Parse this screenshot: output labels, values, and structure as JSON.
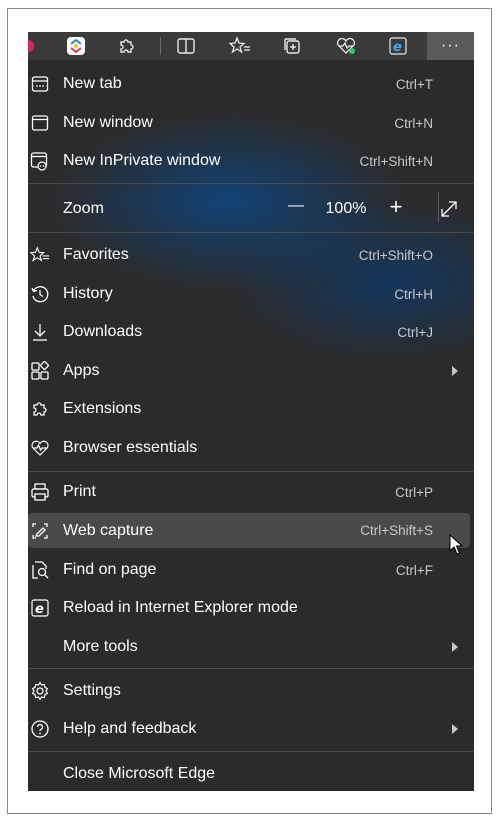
{
  "toolbar": {
    "icons": [
      "profile-icon",
      "copilot-icon",
      "extensions-icon",
      "split-screen-icon",
      "favorites-icon",
      "collections-icon",
      "browser-essentials-icon",
      "ie-mode-icon"
    ],
    "more_label": "···"
  },
  "menu": {
    "items": [
      {
        "label": "New tab",
        "shortcut": "Ctrl+T",
        "icon": "new-tab-icon"
      },
      {
        "label": "New window",
        "shortcut": "Ctrl+N",
        "icon": "new-window-icon"
      },
      {
        "label": "New InPrivate window",
        "shortcut": "Ctrl+Shift+N",
        "icon": "inprivate-icon"
      },
      {
        "label": "Zoom",
        "icon": ""
      },
      {
        "label": "Favorites",
        "shortcut": "Ctrl+Shift+O",
        "icon": "favorites-icon"
      },
      {
        "label": "History",
        "shortcut": "Ctrl+H",
        "icon": "history-icon"
      },
      {
        "label": "Downloads",
        "shortcut": "Ctrl+J",
        "icon": "downloads-icon"
      },
      {
        "label": "Apps",
        "icon": "apps-icon"
      },
      {
        "label": "Extensions",
        "icon": "extensions-icon"
      },
      {
        "label": "Browser essentials",
        "icon": "browser-essentials-icon"
      },
      {
        "label": "Print",
        "shortcut": "Ctrl+P",
        "icon": "print-icon"
      },
      {
        "label": "Web capture",
        "shortcut": "Ctrl+Shift+S",
        "icon": "web-capture-icon"
      },
      {
        "label": "Find on page",
        "shortcut": "Ctrl+F",
        "icon": "find-icon"
      },
      {
        "label": "Reload in Internet Explorer mode",
        "icon": "ie-mode-icon"
      },
      {
        "label": "More tools",
        "icon": ""
      },
      {
        "label": "Settings",
        "icon": "settings-icon"
      },
      {
        "label": "Help and feedback",
        "icon": "help-icon"
      },
      {
        "label": "Close Microsoft Edge",
        "icon": ""
      }
    ],
    "zoom": {
      "minus": "—",
      "value": "100%",
      "plus": "+"
    }
  },
  "colors": {
    "menu_bg": "#2b2b2b",
    "toolbar_bg": "#3a3a3a",
    "hover_bg": "#4a4a4a",
    "accent_glow": "#0c4682"
  }
}
